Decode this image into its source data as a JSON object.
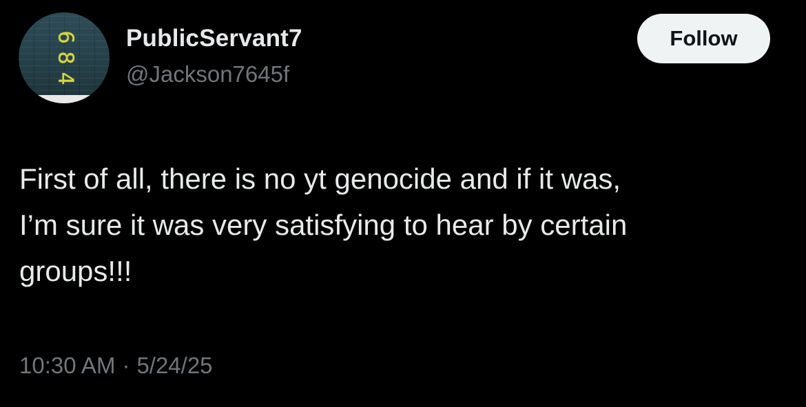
{
  "author": {
    "display_name": "PublicServant7",
    "handle": "@Jackson7645f",
    "avatar_digits": [
      "6",
      "8",
      "4"
    ]
  },
  "follow_button": {
    "label": "Follow"
  },
  "tweet": {
    "text_lines": [
      "First of all, there is no yt genocide and if it was,",
      "I’m sure it was very satisfying to hear by certain",
      "groups!!!"
    ],
    "time": "10:30 AM",
    "separator": "·",
    "date": "5/24/25"
  },
  "colors": {
    "background": "#000000",
    "primary_text": "#e7e9ea",
    "secondary_text": "#71767b",
    "follow_button_bg": "#eff3f4",
    "follow_button_text": "#0f1419",
    "avatar_digit": "#d8d53a"
  },
  "icons": {
    "avatar": "profile-avatar"
  }
}
